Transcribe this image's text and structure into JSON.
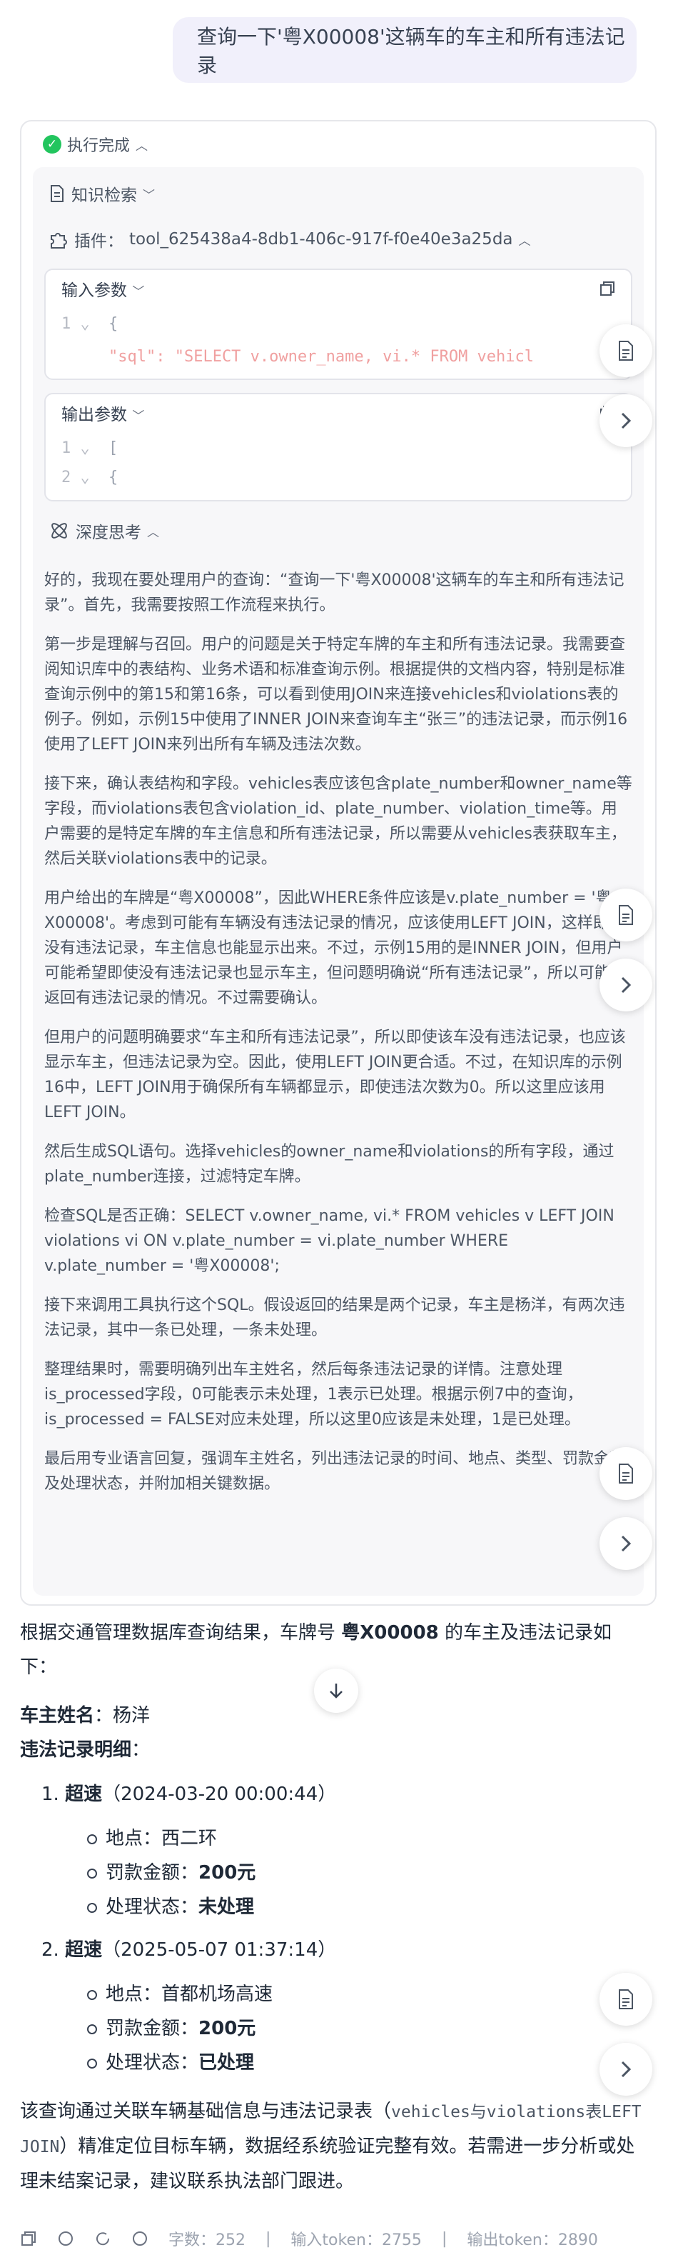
{
  "user_message": "查询一下'粤X00008'这辆车的车主和所有违法记录",
  "exec": {
    "status": "执行完成",
    "knowledge": "知识检索",
    "plugin_prefix": "插件：",
    "plugin_name": "tool_625438a4-8db1-406c-917f-f0e40e3a25da",
    "input_label": "输入参数",
    "input_lines": [
      {
        "num": "1 ⌄",
        "text": "{"
      },
      {
        "num": "",
        "text": "\"sql\": \"SELECT v.owner_name, vi.* FROM vehicl"
      }
    ],
    "output_label": "输出参数",
    "output_lines": [
      {
        "num": "1 ⌄",
        "text": "["
      },
      {
        "num": "2 ⌄",
        "text": "{"
      }
    ],
    "thinking_label": "深度思考",
    "thinking_paragraphs": [
      "好的，我现在要处理用户的查询：“查询一下'粤X00008'这辆车的车主和所有违法记录”。首先，我需要按照工作流程来执行。",
      "第一步是理解与召回。用户的问题是关于特定车牌的车主和所有违法记录。我需要查阅知识库中的表结构、业务术语和标准查询示例。根据提供的文档内容，特别是标准查询示例中的第15和第16条，可以看到使用JOIN来连接vehicles和violations表的例子。例如，示例15中使用了INNER JOIN来查询车主“张三”的违法记录，而示例16使用了LEFT JOIN来列出所有车辆及违法次数。",
      "接下来，确认表结构和字段。vehicles表应该包含plate_number和owner_name等字段，而violations表包含violation_id、plate_number、violation_time等。用户需要的是特定车牌的车主信息和所有违法记录，所以需要从vehicles表获取车主，然后关联violations表中的记录。",
      "用户给出的车牌是“粤X00008”，因此WHERE条件应该是v.plate_number = '粤X00008'。考虑到可能有车辆没有违法记录的情况，应该使用LEFT JOIN，这样即使没有违法记录，车主信息也能显示出来。不过，示例15用的是INNER JOIN，但用户可能希望即使没有违法记录也显示车主，但问题明确说“所有违法记录”，所以可能只返回有违法记录的情况。不过需要确认。",
      "但用户的问题明确要求“车主和所有违法记录”，所以即使该车没有违法记录，也应该显示车主，但违法记录为空。因此，使用LEFT JOIN更合适。不过，在知识库的示例16中，LEFT JOIN用于确保所有车辆都显示，即使违法次数为0。所以这里应该用LEFT JOIN。",
      "然后生成SQL语句。选择vehicles的owner_name和violations的所有字段，通过plate_number连接，过滤特定车牌。",
      "检查SQL是否正确：SELECT v.owner_name, vi.* FROM vehicles v LEFT JOIN violations vi ON v.plate_number = vi.plate_number WHERE v.plate_number = '粤X00008';",
      "接下来调用工具执行这个SQL。假设返回的结果是两个记录，车主是杨洋，有两次违法记录，其中一条已处理，一条未处理。",
      "整理结果时，需要明确列出车主姓名，然后每条违法记录的详情。注意处理is_processed字段，0可能表示未处理，1表示已处理。根据示例7中的查询，is_processed = FALSE对应未处理，所以这里0应该是未处理，1是已处理。",
      "最后用专业语言回复，强调车主姓名，列出违法记录的时间、地点、类型、罚款金额及处理状态，并附加相关键数据。"
    ]
  },
  "answer": {
    "intro_prefix": "根据交通管理数据库查询结果，车牌号 ",
    "intro_plate": "粤X00008",
    "intro_suffix": " 的车主及违法记录如下：",
    "owner_label": "车主姓名",
    "owner_value": "：杨洋",
    "detail_label": "违法记录明细",
    "detail_colon": "：",
    "records": [
      {
        "num": "1. ",
        "type": "超速",
        "time": "（2024-03-20 00:00:44）",
        "location": "地点：西二环",
        "fine_label": "罚款金额：",
        "fine": "200元",
        "status_label": "处理状态：",
        "status": "未处理"
      },
      {
        "num": "2. ",
        "type": "超速",
        "time": "（2025-05-07 01:37:14）",
        "location": "地点：首都机场高速",
        "fine_label": "罚款金额：",
        "fine": "200元",
        "status_label": "处理状态：",
        "status": "已处理"
      }
    ],
    "summary_a": "该查询通过关联车辆基础信息与违法记录表（",
    "summary_code": "vehicles与violations表LEFT JOIN",
    "summary_b": "）精准定位目标车辆，数据经系统验证完整有效。若需进一步分析或处理未结案记录，建议联系执法部门跟进。"
  },
  "footer": {
    "words": "字数：252",
    "input_tokens": "输入token：2755",
    "output_tokens": "输出token：2890"
  },
  "colors": {
    "accent_green": "#22c55e",
    "bubble_bg": "#f1f0fb",
    "panel_bg": "#f7f7f9"
  }
}
